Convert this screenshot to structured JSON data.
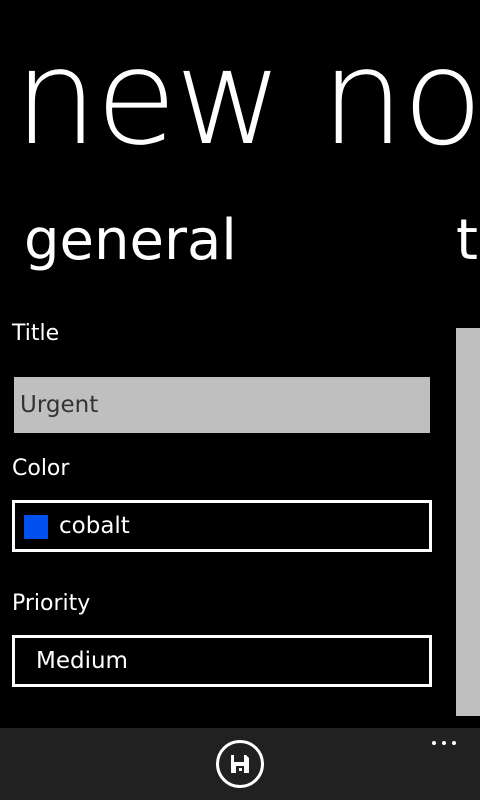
{
  "page": {
    "title": "new no"
  },
  "pivot": {
    "items": [
      {
        "label": "general"
      },
      {
        "label": "te"
      }
    ]
  },
  "form": {
    "title_label": "Title",
    "title_value": "Urgent",
    "color_label": "Color",
    "color_value": "cobalt",
    "color_swatch": "#0050ef",
    "priority_label": "Priority",
    "priority_value": "Medium"
  },
  "appbar": {
    "save_icon": "save-icon",
    "more_icon": "ellipsis-icon"
  },
  "colors": {
    "background": "#000000",
    "foreground": "#ffffff",
    "textbox_background": "#bfbfbf",
    "appbar_background": "#212121"
  }
}
